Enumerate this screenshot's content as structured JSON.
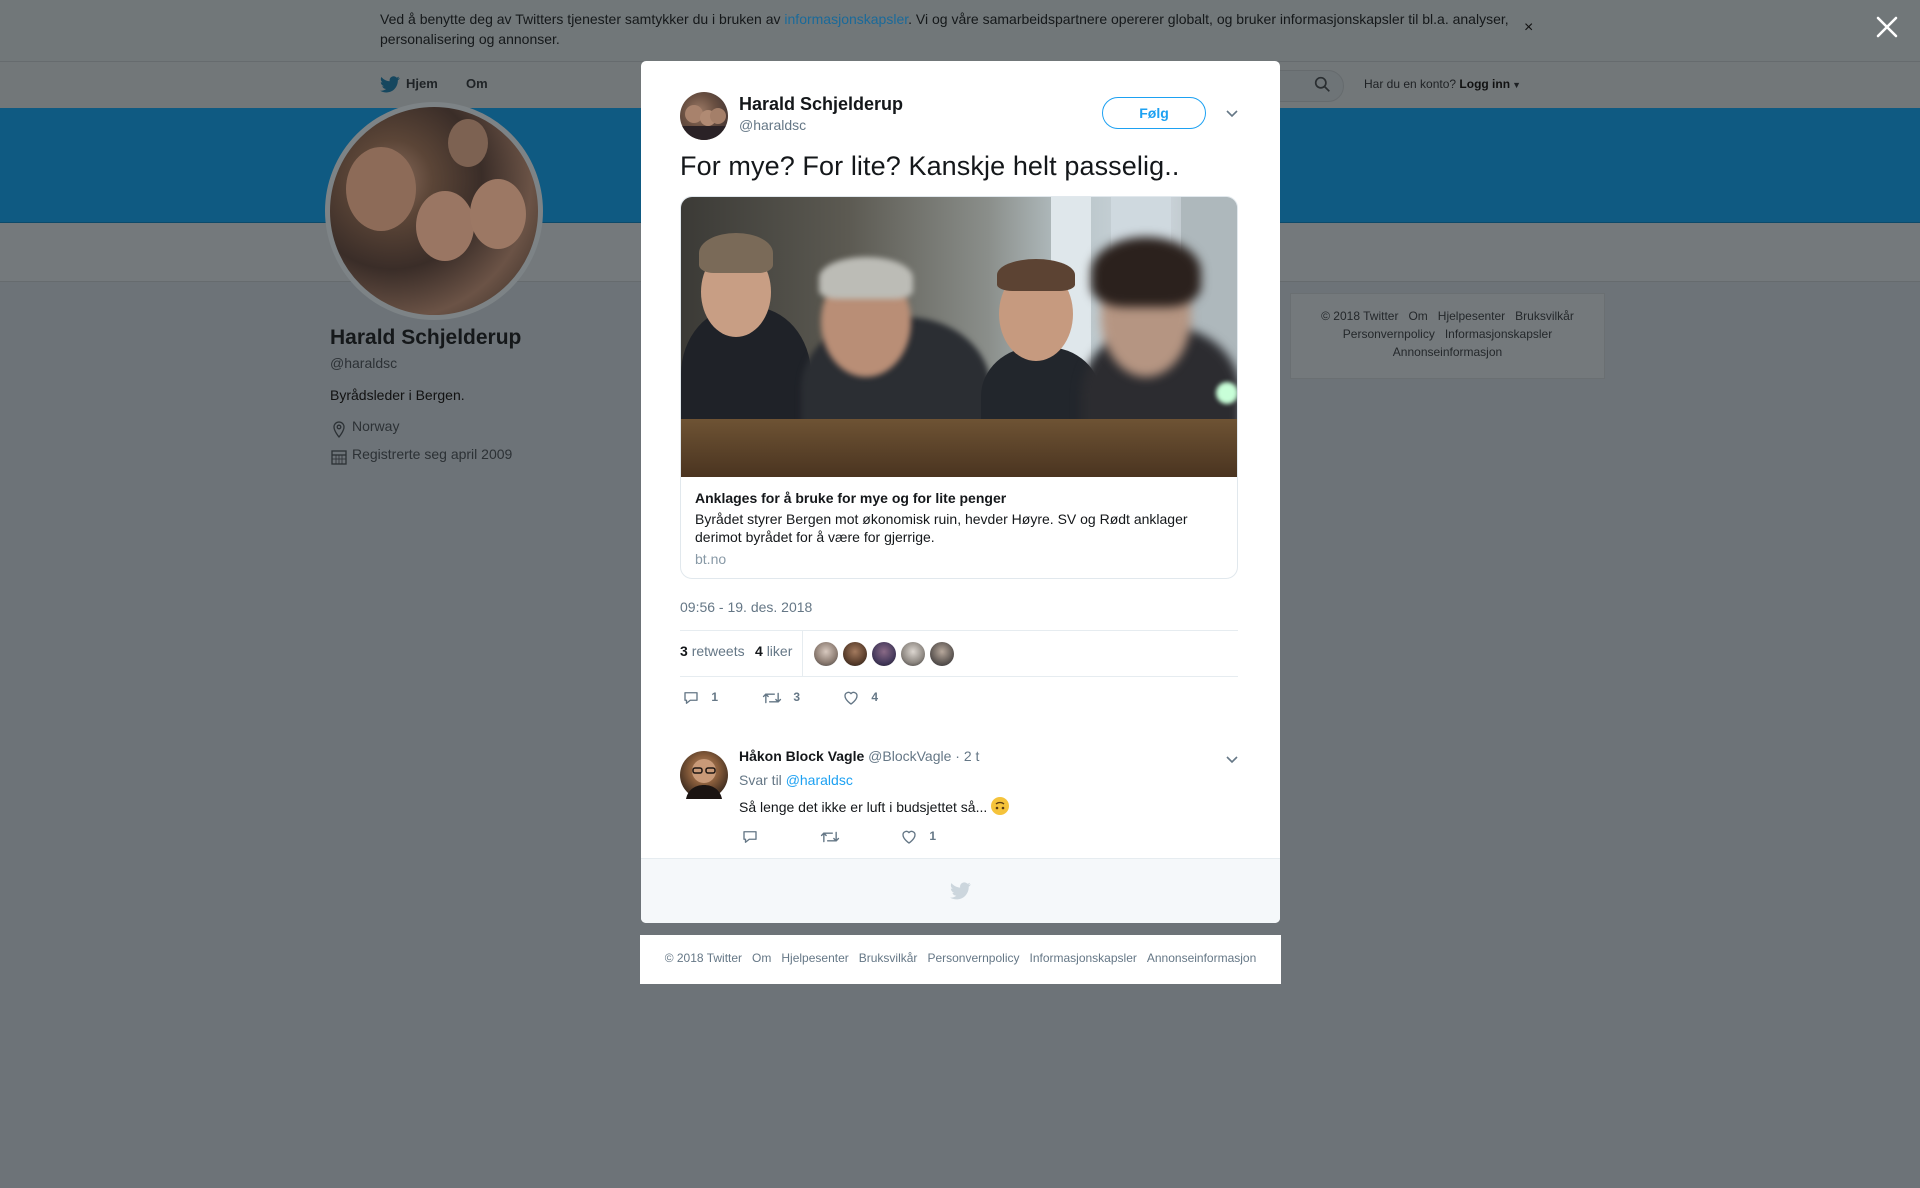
{
  "cookie": {
    "text_before": "Ved å benytte deg av Twitters tjenester samtykker du i bruken av ",
    "link": "informasjonskapsler",
    "text_after": ". Vi og våre samarbeidspartnere opererer globalt, og bruker informasjonskapsler til bl.a. analyser, personalisering og annonser.",
    "close": "×"
  },
  "nav": {
    "home": "Hjem",
    "about": "Om",
    "login_prompt": "Har du en konto?",
    "login": "Logg inn"
  },
  "profile": {
    "name": "Harald Schjelderup",
    "handle": "@haraldsc",
    "bio": "Byrådsleder i Bergen.",
    "location": "Norway",
    "joined": "Registrerte seg april 2009"
  },
  "side_footer": {
    "line1": [
      "© 2018 Twitter",
      "Om",
      "Hjelpesenter",
      "Bruksvilkår"
    ],
    "line2": [
      "Personvernpolicy",
      "Informasjonskapsler"
    ],
    "line3": [
      "Annonseinformasjon"
    ]
  },
  "tweet": {
    "name": "Harald Schjelderup",
    "handle": "@haraldsc",
    "follow": "Følg",
    "text": "For mye? For lite? Kanskje helt passelig..",
    "card": {
      "title": "Anklages for å bruke for mye og for lite penger",
      "description": "Byrådet styrer Bergen mot økonomisk ruin, hevder Høyre. SV og Rødt anklager derimot byrådet for å være for gjerrige.",
      "domain": "bt.no"
    },
    "time": "09:56 - 19. des. 2018",
    "retweets_count": "3",
    "retweets_label": "retweets",
    "likes_count": "4",
    "likes_label": "liker",
    "reply_count": "1",
    "retweet_count": "3",
    "like_count": "4"
  },
  "reply": {
    "name": "Håkon Block Vagle",
    "handle": "@BlockVagle",
    "time": "· 2 t",
    "to_label": "Svar til",
    "to_handle": "@haraldsc",
    "text": "Så lenge det ikke er luft i budsjettet så...",
    "like_count": "1"
  },
  "bottom_footer": [
    "© 2018 Twitter",
    "Om",
    "Hjelpesenter",
    "Bruksvilkår",
    "Personvernpolicy",
    "Informasjonskapsler",
    "Annonseinformasjon"
  ],
  "colors": {
    "accent": "#1da1f2",
    "banner": "#1b9be0",
    "overlay": "rgba(0,0,0,0.55)"
  },
  "icons": [
    "twitter-bird-icon",
    "search-icon",
    "location-icon",
    "calendar-icon",
    "chevron-down-icon",
    "reply-icon",
    "retweet-icon",
    "heart-icon",
    "close-icon",
    "upside-down-face-emoji"
  ]
}
